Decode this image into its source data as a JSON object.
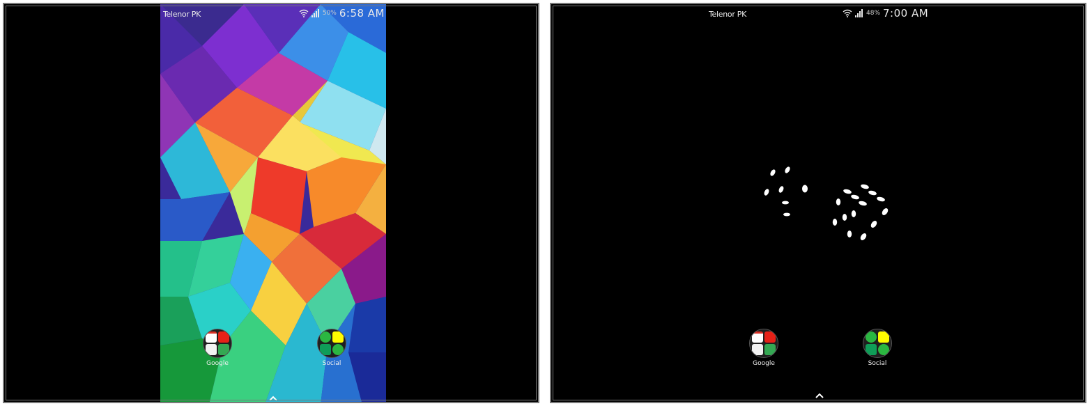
{
  "screens": [
    {
      "carrier": "Telenor PK",
      "battery": "50%",
      "time": "6:58 AM",
      "wallpaper": "colorful-polygon",
      "folders": [
        {
          "label": "Google",
          "icons": [
            "gmail-icon",
            "youtube-icon",
            "maps-icon",
            "drive-icon"
          ]
        },
        {
          "label": "Social",
          "icons": [
            "whatsapp-icon",
            "snapchat-icon",
            "hangouts-icon",
            "phone-icon"
          ]
        }
      ]
    },
    {
      "carrier": "Telenor PK",
      "battery": "48%",
      "time": "7:00 AM",
      "wallpaper": "black-dice",
      "folders": [
        {
          "label": "Google",
          "icons": [
            "gmail-icon",
            "youtube-icon",
            "maps-icon",
            "drive-icon"
          ]
        },
        {
          "label": "Social",
          "icons": [
            "whatsapp-icon",
            "snapchat-icon",
            "hangouts-icon",
            "phone-icon"
          ]
        }
      ]
    }
  ],
  "colors": {
    "background": "#000000",
    "frame": "#7a7a7a",
    "status_text": "#e9e9e9"
  }
}
